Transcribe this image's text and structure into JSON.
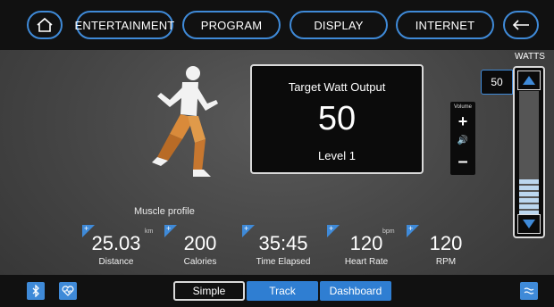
{
  "colors": {
    "accent": "#3f8ad8",
    "topbar_bg": "#111111",
    "card_bg": "#0b0b0b",
    "muscle_highlight": "#d98a3a"
  },
  "nav": {
    "home_icon": "home-icon",
    "items": [
      "ENTERTAINMENT",
      "PROGRAM",
      "DISPLAY",
      "INTERNET"
    ],
    "back_icon": "back-arrow-icon"
  },
  "muscle_profile": {
    "label": "Muscle profile"
  },
  "target": {
    "title": "Target Watt Output",
    "value": "50",
    "level": "Level 1"
  },
  "volume": {
    "label": "Volume",
    "plus": "+",
    "minus": "–",
    "speaker_icon": "speaker-icon"
  },
  "watts": {
    "label": "WATTS",
    "value": "50",
    "level_bars_filled": 6
  },
  "stats": [
    {
      "value": "25.03",
      "unit": "km",
      "label": "Distance"
    },
    {
      "value": "200",
      "unit": "",
      "label": "Calories"
    },
    {
      "value": "35:45",
      "unit": "",
      "label": "Time Elapsed"
    },
    {
      "value": "120",
      "unit": "bpm",
      "label": "Heart Rate"
    },
    {
      "value": "120",
      "unit": "",
      "label": "RPM"
    }
  ],
  "bottom": {
    "bluetooth_icon": "bluetooth-icon",
    "heart_icon": "heart-monitor-icon",
    "tabs": [
      "Simple",
      "Track",
      "Dashboard"
    ],
    "active_tab": "Simple",
    "menu_icon": "waves-menu-icon"
  }
}
